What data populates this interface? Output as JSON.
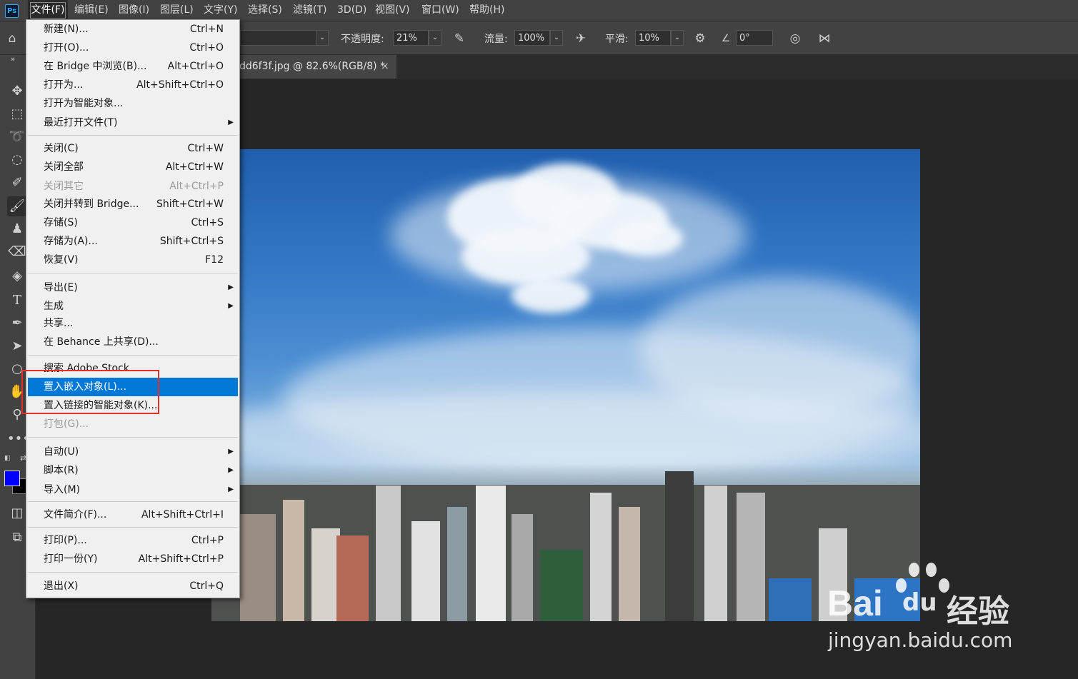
{
  "menubar": {
    "logo": "Ps",
    "items": [
      "文件(F)",
      "编辑(E)",
      "图像(I)",
      "图层(L)",
      "文字(Y)",
      "选择(S)",
      "滤镜(T)",
      "3D(D)",
      "视图(V)",
      "窗口(W)",
      "帮助(H)"
    ]
  },
  "options": {
    "opacity_label": "不透明度:",
    "opacity_value": "21%",
    "flow_label": "流量:",
    "flow_value": "100%",
    "smooth_label": "平滑:",
    "smooth_value": "10%",
    "angle_value": "0°"
  },
  "document_tab": {
    "title": "dd6f3f.jpg @ 82.6%(RGB/8) *",
    "close": "×"
  },
  "file_menu": {
    "items": [
      {
        "label": "新建(N)...",
        "shortcut": "Ctrl+N"
      },
      {
        "label": "打开(O)...",
        "shortcut": "Ctrl+O"
      },
      {
        "label": "在 Bridge 中浏览(B)...",
        "shortcut": "Alt+Ctrl+O"
      },
      {
        "label": "打开为...",
        "shortcut": "Alt+Shift+Ctrl+O"
      },
      {
        "label": "打开为智能对象...",
        "shortcut": ""
      },
      {
        "label": "最近打开文件(T)",
        "shortcut": "",
        "submenu": true
      },
      {
        "label": "关闭(C)",
        "shortcut": "Ctrl+W"
      },
      {
        "label": "关闭全部",
        "shortcut": "Alt+Ctrl+W"
      },
      {
        "label": "关闭其它",
        "shortcut": "Alt+Ctrl+P",
        "disabled": true
      },
      {
        "label": "关闭并转到 Bridge...",
        "shortcut": "Shift+Ctrl+W"
      },
      {
        "label": "存储(S)",
        "shortcut": "Ctrl+S"
      },
      {
        "label": "存储为(A)...",
        "shortcut": "Shift+Ctrl+S"
      },
      {
        "label": "恢复(V)",
        "shortcut": "F12"
      },
      {
        "label": "导出(E)",
        "shortcut": "",
        "submenu": true
      },
      {
        "label": "生成",
        "shortcut": "",
        "submenu": true
      },
      {
        "label": "共享...",
        "shortcut": ""
      },
      {
        "label": "在 Behance 上共享(D)...",
        "shortcut": ""
      },
      {
        "label": "搜索 Adobe Stock...",
        "shortcut": ""
      },
      {
        "label": "置入嵌入对象(L)...",
        "shortcut": "",
        "highlighted": true
      },
      {
        "label": "置入链接的智能对象(K)...",
        "shortcut": ""
      },
      {
        "label": "打包(G)...",
        "shortcut": "",
        "disabled": true
      },
      {
        "label": "自动(U)",
        "shortcut": "",
        "submenu": true
      },
      {
        "label": "脚本(R)",
        "shortcut": "",
        "submenu": true
      },
      {
        "label": "导入(M)",
        "shortcut": "",
        "submenu": true
      },
      {
        "label": "文件简介(F)...",
        "shortcut": "Alt+Shift+Ctrl+I"
      },
      {
        "label": "打印(P)...",
        "shortcut": "Ctrl+P"
      },
      {
        "label": "打印一份(Y)",
        "shortcut": "Alt+Shift+Ctrl+P"
      },
      {
        "label": "退出(X)",
        "shortcut": "Ctrl+Q"
      }
    ]
  },
  "colors": {
    "foreground": "#0000ff",
    "background": "#000000",
    "highlight": "#0078d7",
    "annotation_box": "#e0312b"
  },
  "watermark": {
    "brand": "Bai",
    "brand2": "du",
    "cn": "经验",
    "url": "jingyan.baidu.com"
  }
}
